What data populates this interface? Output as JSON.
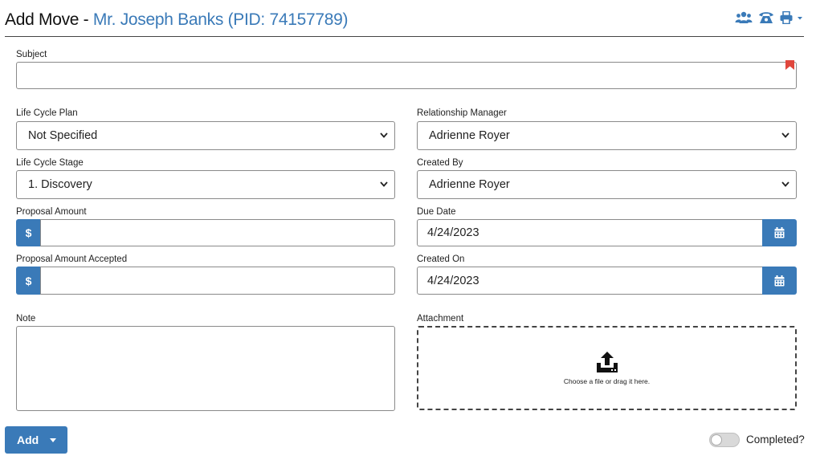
{
  "header": {
    "title_main": "Add Move - ",
    "title_sub": "Mr. Joseph Banks (PID: 74157789)",
    "icons": [
      "users-icon",
      "phone-icon",
      "print-icon",
      "chevron-down-icon"
    ]
  },
  "form": {
    "subject": {
      "label": "Subject",
      "value": ""
    },
    "life_cycle_plan": {
      "label": "Life Cycle Plan",
      "value": "Not Specified"
    },
    "relationship_manager": {
      "label": "Relationship Manager",
      "value": "Adrienne Royer"
    },
    "life_cycle_stage": {
      "label": "Life Cycle Stage",
      "value": "1. Discovery"
    },
    "created_by": {
      "label": "Created By",
      "value": "Adrienne Royer"
    },
    "proposal_amount": {
      "label": "Proposal Amount",
      "prefix": "$",
      "value": ""
    },
    "due_date": {
      "label": "Due Date",
      "value": "4/24/2023"
    },
    "proposal_amount_accepted": {
      "label": "Proposal Amount Accepted",
      "prefix": "$",
      "value": ""
    },
    "created_on": {
      "label": "Created On",
      "value": "4/24/2023"
    },
    "note": {
      "label": "Note",
      "value": ""
    },
    "attachment": {
      "label": "Attachment",
      "dropzone_text": "Choose a file or drag it here."
    }
  },
  "footer": {
    "add_label": "Add",
    "completed_label": "Completed?",
    "completed": false
  },
  "colors": {
    "accent": "#3a7ab8",
    "bookmark": "#e0463c",
    "title_sub": "#3a7ab8"
  }
}
